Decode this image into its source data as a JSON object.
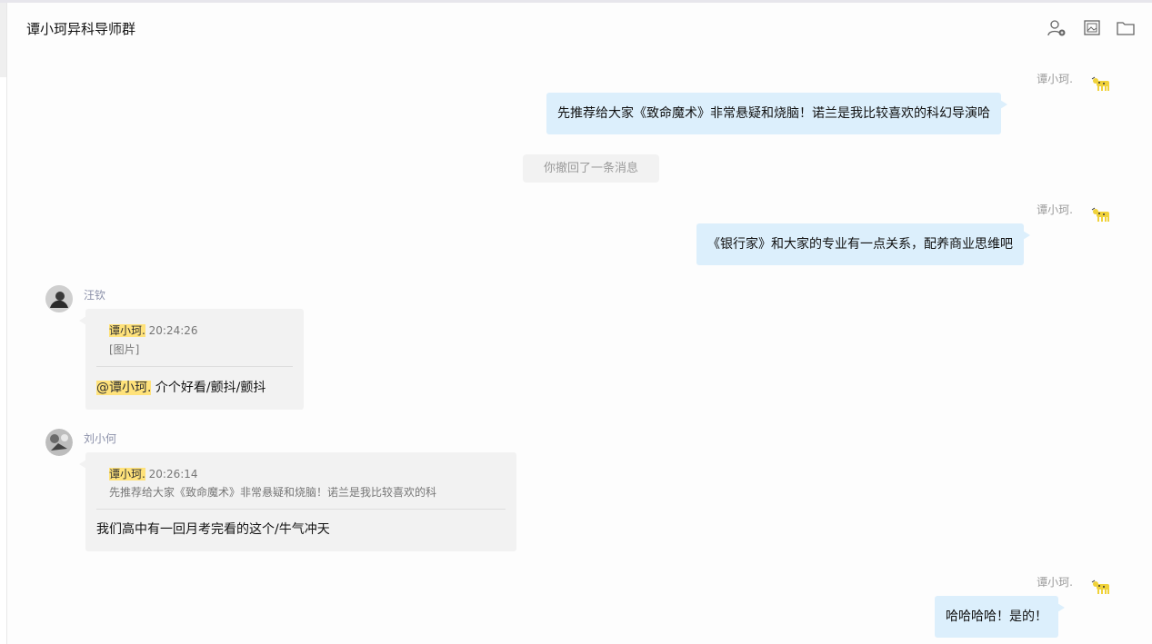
{
  "header": {
    "title": "谭小珂异科导师群",
    "icons": [
      "add-member-icon",
      "image-icon",
      "folder-icon"
    ]
  },
  "messages": [
    {
      "sender": "谭小珂.",
      "text": "先推荐给大家《致命魔术》非常悬疑和烧脑！诺兰是我比较喜欢的科幻导演哈"
    },
    {
      "system": "你撤回了一条消息"
    },
    {
      "sender": "谭小珂.",
      "text": "《银行家》和大家的专业有一点关系，配养商业思维吧"
    },
    {
      "sender": "汪钦",
      "quote_name": "谭小珂.",
      "quote_time": "20:24:26",
      "quote_text": "[图片]",
      "mention": "@谭小珂.",
      "text": " 介个好看/颤抖/颤抖"
    },
    {
      "sender": "刘小何",
      "quote_name": "谭小珂.",
      "quote_time": "20:26:14",
      "quote_text": "先推荐给大家《致命魔术》非常悬疑和烧脑！诺兰是我比较喜欢的科",
      "text": "我们高中有一回月考完看的这个/牛气冲天"
    },
    {
      "sender": "谭小珂.",
      "text": "哈哈哈哈！是的！"
    }
  ],
  "colors": {
    "my_bubble": "#dceffc",
    "other_bubble": "#f2f2f2",
    "mention_highlight": "#ffe27a"
  }
}
